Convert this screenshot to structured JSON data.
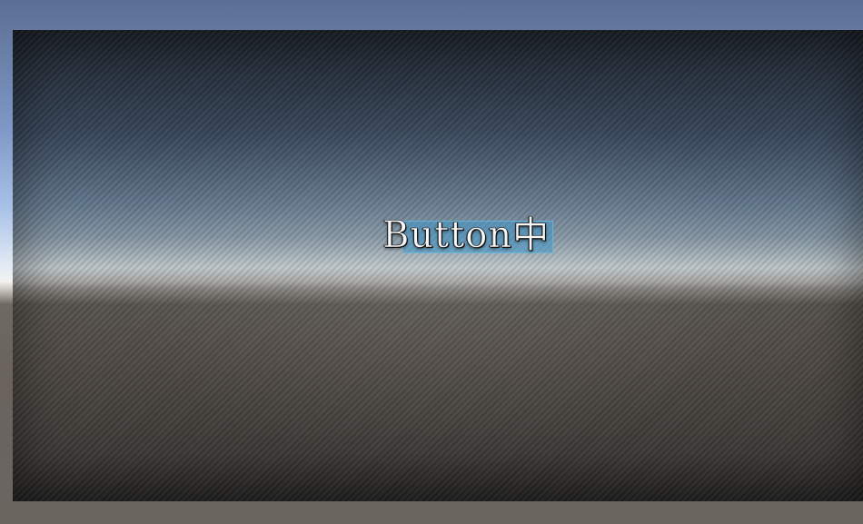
{
  "scene": {
    "button": {
      "label": "Button中"
    }
  },
  "colors": {
    "sky_top": "#5a6f96",
    "horizon": "#f2f2f0",
    "ground": "#6b6560",
    "selection_highlight": "#4096c8",
    "label_text": "#f7f7f7"
  }
}
